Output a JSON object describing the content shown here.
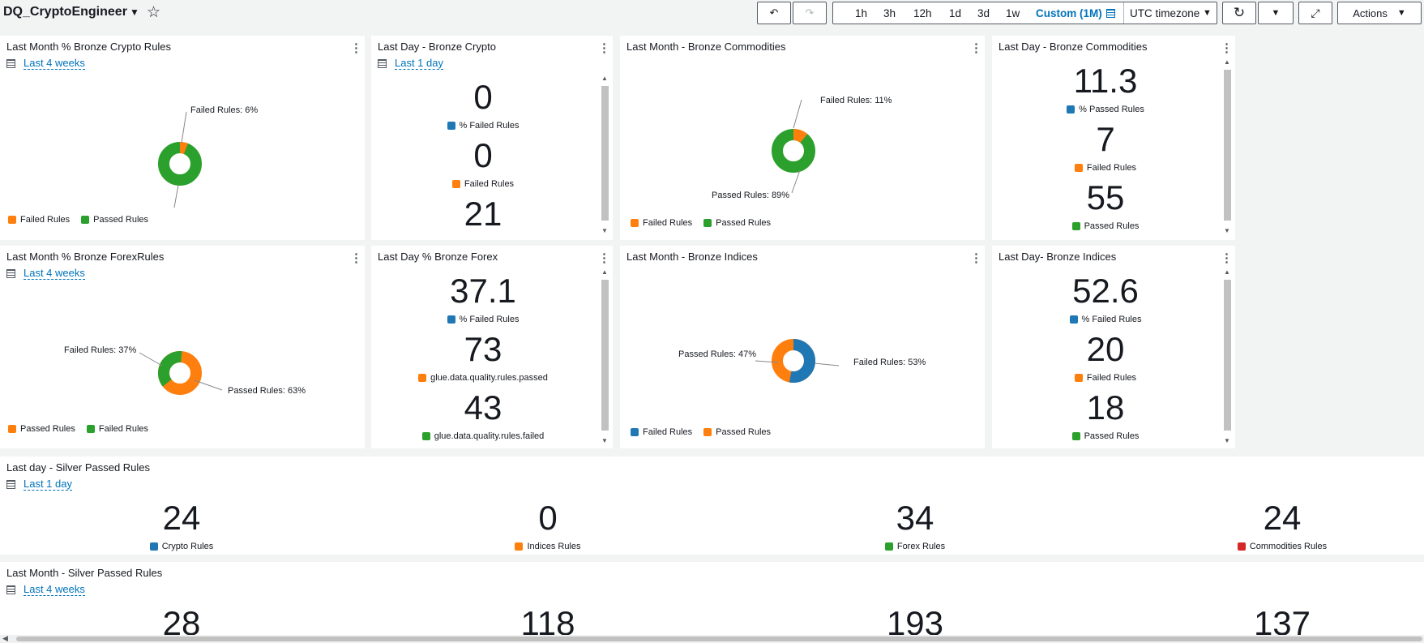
{
  "dashboard": {
    "title": "DQ_CryptoEngineer"
  },
  "toolbar": {
    "time_ranges": [
      "1h",
      "3h",
      "12h",
      "1d",
      "3d",
      "1w"
    ],
    "custom_label": "Custom (1M)",
    "timezone": "UTC timezone",
    "actions_label": "Actions"
  },
  "panels": {
    "p1": {
      "title": "Last Month % Bronze Crypto Rules",
      "period": "Last 4 weeks",
      "callout_failed": "Failed Rules: 6%",
      "legend": [
        "Failed Rules",
        "Passed Rules"
      ]
    },
    "p2": {
      "title": "Last Day - Bronze Crypto",
      "period": "Last 1 day",
      "n1": "0",
      "l1": "% Failed Rules",
      "n2": "0",
      "l2": "Failed Rules",
      "n3": "21"
    },
    "p3": {
      "title": "Last Month - Bronze Commodities",
      "callout_failed": "Failed Rules: 11%",
      "callout_passed": "Passed Rules: 89%",
      "legend": [
        "Failed Rules",
        "Passed Rules"
      ]
    },
    "p4": {
      "title": "Last Day - Bronze Commodities",
      "n1": "11.3",
      "l1": "% Passed Rules",
      "n2": "7",
      "l2": "Failed Rules",
      "n3": "55",
      "l3": "Passed Rules"
    },
    "p5": {
      "title": "Last Month % Bronze ForexRules",
      "period": "Last 4 weeks",
      "callout_failed": "Failed Rules: 37%",
      "callout_passed": "Passed Rules: 63%",
      "legend": [
        "Passed Rules",
        "Failed Rules"
      ]
    },
    "p6": {
      "title": "Last Day % Bronze Forex",
      "n1": "37.1",
      "l1": "% Failed Rules",
      "n2": "73",
      "l2": "glue.data.quality.rules.passed",
      "n3": "43",
      "l3": "glue.data.quality.rules.failed"
    },
    "p7": {
      "title": "Last Month - Bronze Indices",
      "callout_passed": "Passed Rules: 47%",
      "callout_failed": "Failed Rules: 53%",
      "legend": [
        "Failed Rules",
        "Passed Rules"
      ]
    },
    "p8": {
      "title": "Last Day- Bronze Indices",
      "n1": "52.6",
      "l1": "% Failed Rules",
      "n2": "20",
      "l2": "Failed Rules",
      "n3": "18",
      "l3": "Passed Rules"
    },
    "p9": {
      "title": "Last day - Silver Passed Rules",
      "period": "Last 1 day",
      "values": [
        {
          "n": "24",
          "label": "Crypto Rules"
        },
        {
          "n": "0",
          "label": "Indices Rules"
        },
        {
          "n": "34",
          "label": "Forex Rules"
        },
        {
          "n": "24",
          "label": "Commodities Rules"
        }
      ]
    },
    "p10": {
      "title": "Last Month - Silver Passed Rules",
      "period": "Last 4 weeks",
      "values": [
        {
          "n": "28"
        },
        {
          "n": "118"
        },
        {
          "n": "193"
        },
        {
          "n": "137"
        }
      ]
    }
  },
  "donuts": {
    "p1": {
      "failed_pct": 6,
      "passed_pct": 94
    },
    "p3": {
      "failed_pct": 11,
      "passed_pct": 89
    },
    "p5": {
      "failed_pct": 37,
      "passed_pct": 63
    },
    "p7": {
      "failed_pct": 53,
      "passed_pct": 47
    }
  },
  "colors": {
    "blue": "#1f77b4",
    "orange": "#ff7f0e",
    "green": "#2ca02c",
    "red": "#d62728",
    "link": "#0073bb"
  }
}
